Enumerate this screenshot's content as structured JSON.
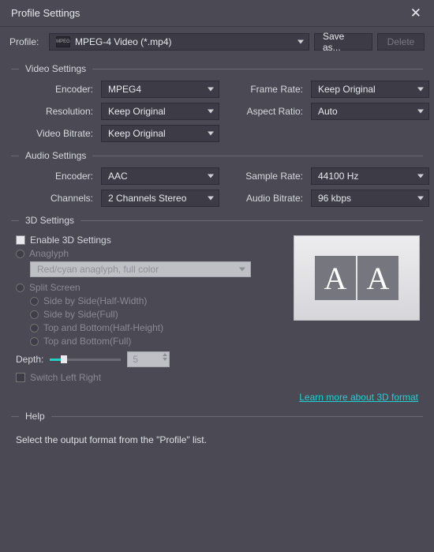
{
  "window": {
    "title": "Profile Settings"
  },
  "profile": {
    "label": "Profile:",
    "value": "MPEG-4 Video (*.mp4)",
    "icon_text": "MPEG",
    "save_as": "Save as...",
    "delete": "Delete"
  },
  "video": {
    "header": "Video Settings",
    "encoder_label": "Encoder:",
    "encoder_value": "MPEG4",
    "resolution_label": "Resolution:",
    "resolution_value": "Keep Original",
    "bitrate_label": "Video Bitrate:",
    "bitrate_value": "Keep Original",
    "framerate_label": "Frame Rate:",
    "framerate_value": "Keep Original",
    "aspect_label": "Aspect Ratio:",
    "aspect_value": "Auto"
  },
  "audio": {
    "header": "Audio Settings",
    "encoder_label": "Encoder:",
    "encoder_value": "AAC",
    "channels_label": "Channels:",
    "channels_value": "2 Channels Stereo",
    "samplerate_label": "Sample Rate:",
    "samplerate_value": "44100 Hz",
    "bitrate_label": "Audio Bitrate:",
    "bitrate_value": "96 kbps"
  },
  "threed": {
    "header": "3D Settings",
    "enable": "Enable 3D Settings",
    "anaglyph": "Anaglyph",
    "anaglyph_value": "Red/cyan anaglyph, full color",
    "split": "Split Screen",
    "sbs_half": "Side by Side(Half-Width)",
    "sbs_full": "Side by Side(Full)",
    "tb_half": "Top and Bottom(Half-Height)",
    "tb_full": "Top and Bottom(Full)",
    "depth_label": "Depth:",
    "depth_value": "5",
    "switch": "Switch Left Right",
    "learn_more": "Learn more about 3D format",
    "preview_a": "A",
    "preview_b": "A"
  },
  "help": {
    "header": "Help",
    "text": "Select the output format from the \"Profile\" list."
  }
}
